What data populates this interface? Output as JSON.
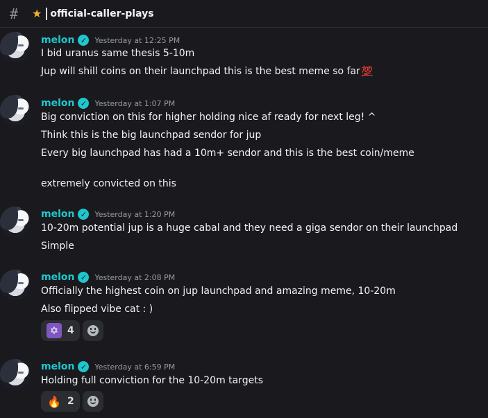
{
  "channel": {
    "hash_icon": "#",
    "star_icon": "★",
    "name": "official-caller-plays"
  },
  "author": "melon",
  "verified_icon": "✓",
  "messages": [
    {
      "time": "Yesterday at 12:25 PM",
      "lines": [
        "I bid uranus same thesis 5-10m",
        "Jup will shill coins on their launchpad this is the best meme so far"
      ],
      "emoji": "💯"
    },
    {
      "time": "Yesterday at 1:07 PM",
      "lines": [
        "Big conviction on this for higher holding nice af ready for next leg! ^",
        "Think this is the big launchpad sendor for jup",
        "Every big launchpad has had a 10m+ sendor and this is the best coin/meme",
        "extremely convicted on this"
      ]
    },
    {
      "time": "Yesterday at 1:20 PM",
      "lines": [
        "10-20m potential jup is a huge cabal and they need a giga sendor on their launchpad",
        "Simple"
      ]
    },
    {
      "time": "Yesterday at 2:08 PM",
      "lines": [
        "Officially the highest coin on jup launchpad and amazing meme, 10-20m",
        "Also flipped vibe cat : )"
      ],
      "reaction": {
        "emoji": "✡",
        "count": "4"
      }
    },
    {
      "time": "Yesterday at 6:59 PM",
      "lines": [
        "Holding full conviction for the 10-20m targets"
      ],
      "reaction": {
        "emoji": "🔥",
        "count": "2"
      }
    }
  ]
}
